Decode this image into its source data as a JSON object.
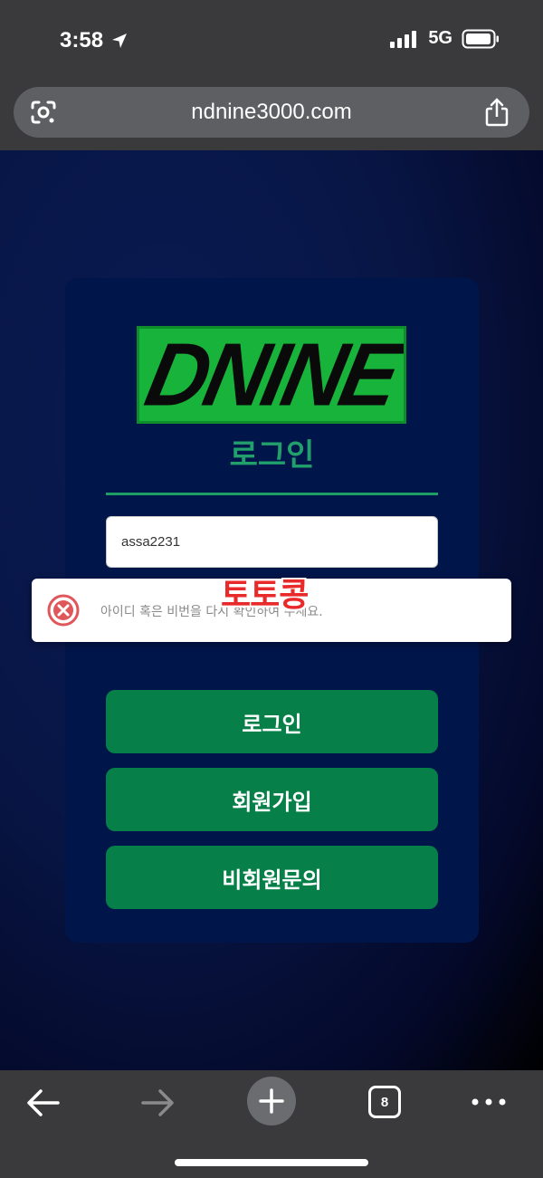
{
  "status_bar": {
    "time": "3:58",
    "network": "5G"
  },
  "browser": {
    "url": "ndnine3000.com",
    "tab_count": "8"
  },
  "page": {
    "logo_text": "DNINE",
    "title": "로그인",
    "id_value": "assa2231",
    "buttons": {
      "login": "로그인",
      "signup": "회원가입",
      "guest_inquiry": "비회원문의"
    }
  },
  "toast": {
    "message": "아이디 혹은 비번을 다시 확인하여 주세요."
  },
  "watermark": "토토콩",
  "colors": {
    "accent_green": "#068048",
    "logo_green": "#17b33a",
    "card_bg": "#00154a",
    "error_red": "#e0575b"
  }
}
